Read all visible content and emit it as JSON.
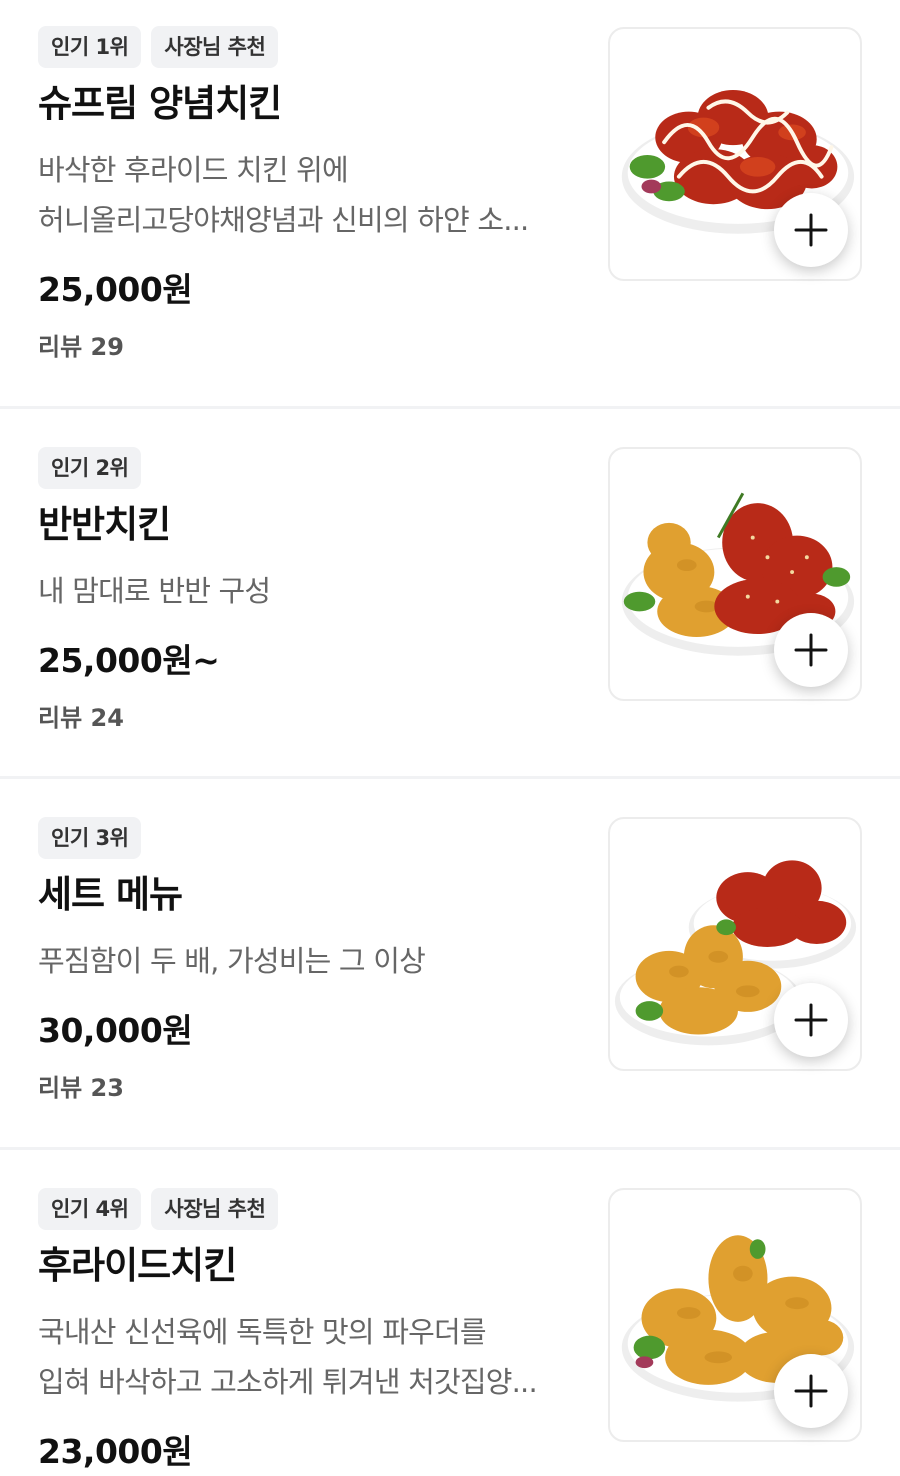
{
  "menu": {
    "items": [
      {
        "badges": [
          "인기 1위",
          "사장님 추천"
        ],
        "name": "슈프림 양념치킨",
        "description_lines": [
          "바삭한 후라이드 치킨 위에",
          "허니올리고당야채양념과 신비의 하얀 소..."
        ],
        "price": "25,000원",
        "review": "리뷰 29",
        "image_icon": "seasoned-chicken-with-white-sauce",
        "add_icon": "plus-icon"
      },
      {
        "badges": [
          "인기 2위"
        ],
        "name": "반반치킨",
        "description_lines": [
          "내 맘대로 반반 구성"
        ],
        "price": "25,000원~",
        "review": "리뷰 24",
        "image_icon": "half-fried-half-seasoned-chicken",
        "add_icon": "plus-icon"
      },
      {
        "badges": [
          "인기 3위"
        ],
        "name": "세트 메뉴",
        "description_lines": [
          "푸짐함이 두 배, 가성비는 그 이상"
        ],
        "price": "30,000원",
        "review": "리뷰 23",
        "image_icon": "two-plates-chicken-set",
        "add_icon": "plus-icon"
      },
      {
        "badges": [
          "인기 4위",
          "사장님 추천"
        ],
        "name": "후라이드치킨",
        "description_lines": [
          "국내산 신선육에 독특한 맛의 파우더를",
          "입혀 바삭하고 고소하게 튀겨낸 처갓집양..."
        ],
        "price": "23,000원",
        "review": "",
        "image_icon": "fried-chicken",
        "add_icon": "plus-icon"
      }
    ]
  },
  "colors": {
    "badge_bg": "#f1f2f4",
    "desc_text": "#666666",
    "seasoned_sauce": "#c8321e",
    "fried_crust": "#e0a030",
    "garnish_green": "#4f9a2e"
  }
}
